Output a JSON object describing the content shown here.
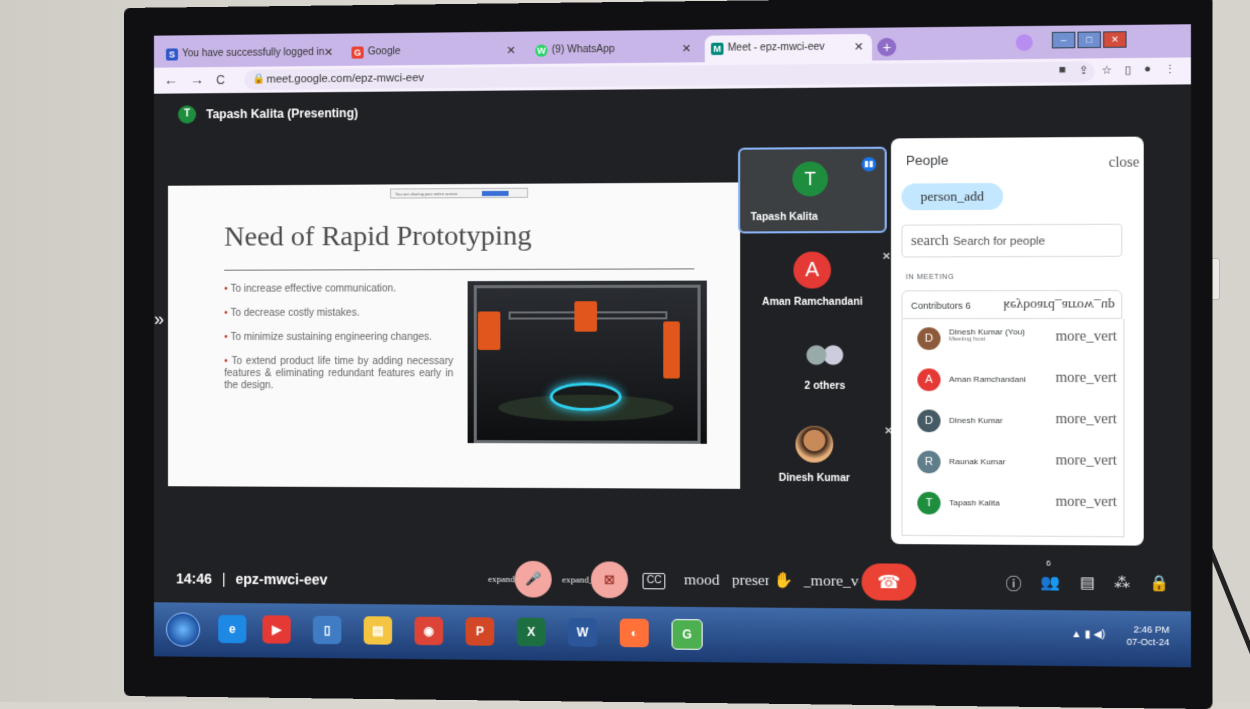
{
  "browser": {
    "tabs": [
      {
        "label": "You have successfully logged in",
        "favicon": "S",
        "color": "#2f57c8"
      },
      {
        "label": "Google",
        "favicon": "G",
        "color": "#ea4335"
      },
      {
        "label": "(9) WhatsApp",
        "favicon": "W",
        "color": "#25d366"
      },
      {
        "label": "Meet - epz-mwci-eev",
        "favicon": "M",
        "color": "#00897b"
      }
    ],
    "close_symbol": "✕",
    "new_tab": "+",
    "url": "meet.google.com/epz-mwci-eev",
    "back": "←",
    "forward": "→",
    "reload": "C"
  },
  "meet": {
    "presenter_initial": "T",
    "presenter_label": "Tapash Kalita (Presenting)",
    "slide": {
      "title": "Need of Rapid Prototyping",
      "bullets": [
        "To increase effective communication.",
        "To decrease costly mistakes.",
        "To minimize sustaining engineering changes.",
        "To extend product life time by adding necessary features & eliminating redundant features early in the design."
      ],
      "bullet_mark": "•",
      "share_bar_text": "You are sharing your entire screen"
    },
    "expand_left": "»",
    "tiles": {
      "main": {
        "initial": "T",
        "name": "Tapash Kalita"
      },
      "aman": {
        "initial": "A",
        "name": "Aman Ramchandani"
      },
      "others": {
        "name": "2 others"
      },
      "dinesh": {
        "name": "Dinesh Kumar"
      }
    }
  },
  "people_panel": {
    "title": "People",
    "close_label": "close",
    "add_label": "person_add",
    "search_icon": "search",
    "search_placeholder": "Search for people",
    "in_meeting": "IN MEETING",
    "contributors": "Contributors  6",
    "contributors_expand": "keyboard_arrow_up",
    "people": [
      {
        "name": "Dinesh Kumar (You)",
        "sub": "Meeting host",
        "initial": "D",
        "color": "#8d5b3b",
        "more": "more_vert"
      },
      {
        "name": "Aman Ramchandani",
        "sub": "",
        "initial": "A",
        "color": "#e53935",
        "more": "more_vert"
      },
      {
        "name": "Dinesh Kumar",
        "sub": "",
        "initial": "D",
        "color": "#455a64",
        "more": "more_vert"
      },
      {
        "name": "Raunak Kumar",
        "sub": "",
        "initial": "R",
        "color": "#607d8b",
        "more": "more_vert"
      },
      {
        "name": "Tapash Kalita",
        "sub": "",
        "initial": "T",
        "color": "#1e8e3e",
        "more": "more_vert"
      }
    ]
  },
  "bottom_bar": {
    "time": "14:46",
    "separator": "|",
    "code": "epz-mwci-eev",
    "mic_label": "expand_less",
    "cam_label": "expand_less",
    "cc": "CC",
    "mood": "mood",
    "present": "present_to_all",
    "hand": "✋",
    "more": "_more_vert",
    "participants_count": "6"
  },
  "taskbar": {
    "time": "2:46 PM",
    "date": "07-Oct-24",
    "apps": [
      {
        "label": "e",
        "color": "#1e88e5"
      },
      {
        "label": "▶",
        "color": "#e53935"
      },
      {
        "label": "▯",
        "color": "#3f7cc4"
      },
      {
        "label": "▤",
        "color": "#f4c542"
      },
      {
        "label": "◉",
        "color": "#db4437"
      },
      {
        "label": "P",
        "color": "#d24726"
      },
      {
        "label": "X",
        "color": "#1d6f42"
      },
      {
        "label": "W",
        "color": "#2b579a"
      },
      {
        "label": "◐",
        "color": "#ff7139"
      },
      {
        "label": "G",
        "color": "#4caf50"
      }
    ]
  }
}
